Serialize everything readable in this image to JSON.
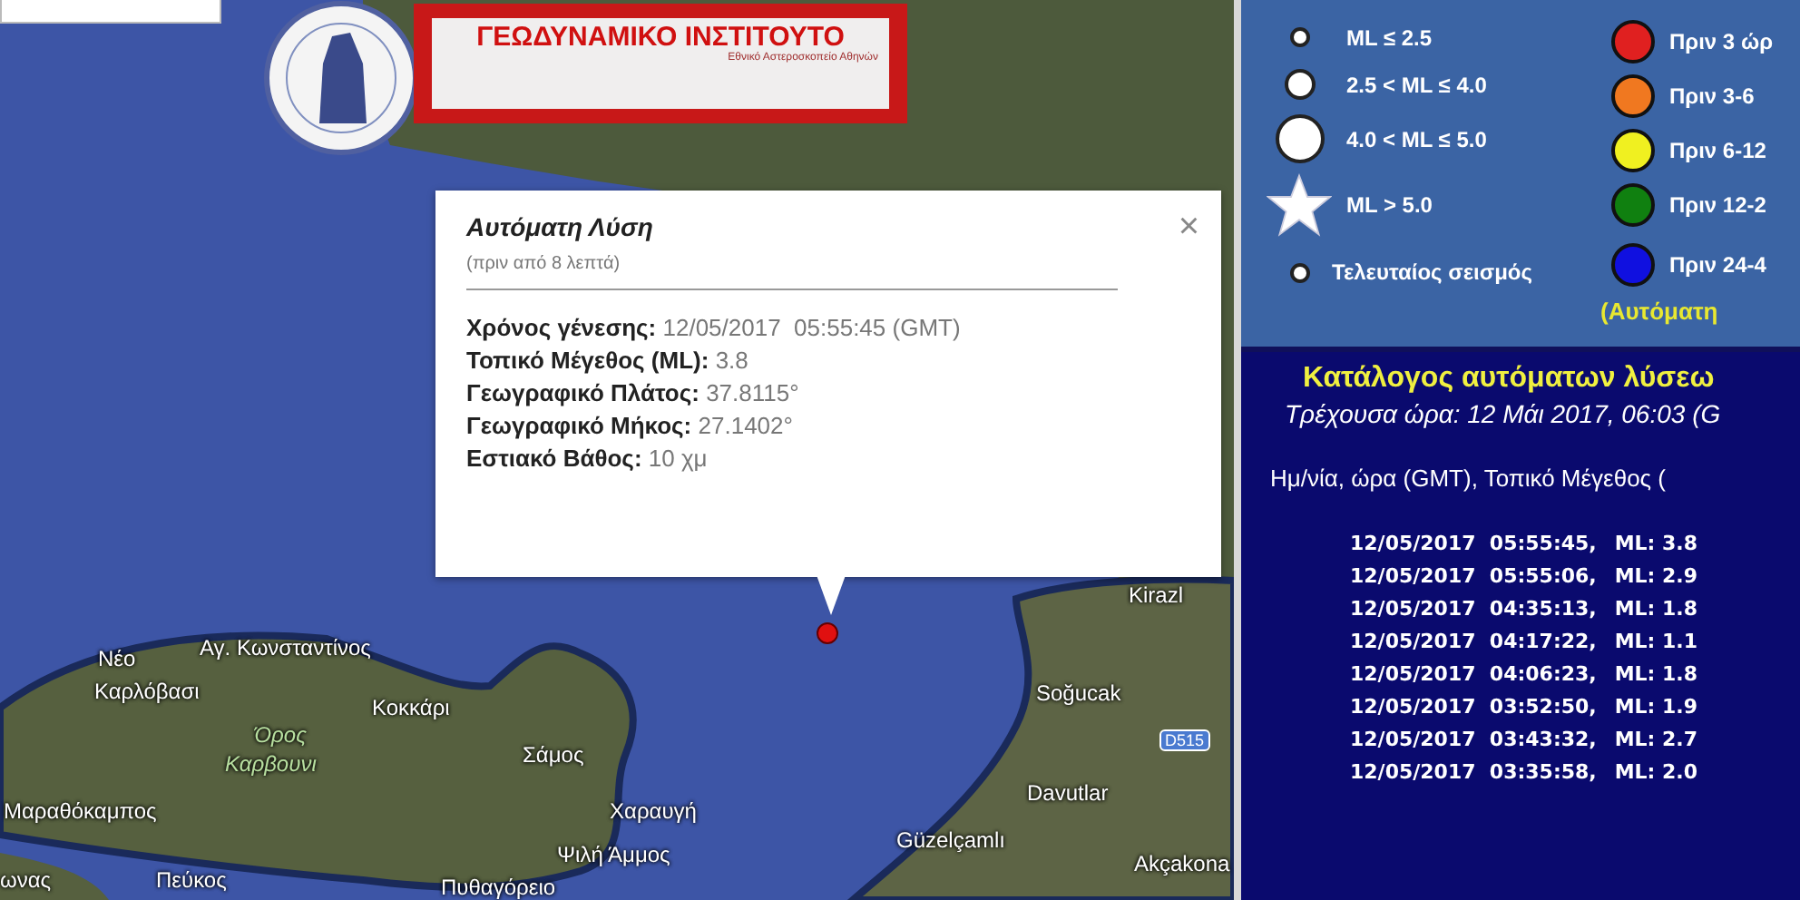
{
  "logo": {
    "title": "ΓΕΩΔΥΝΑΜΙΚΟ ΙΝΣΤΙΤΟΥΤΟ",
    "subtitle": "Εθνικό Αστεροσκοπείο Αθηνών"
  },
  "popup": {
    "title": "Αυτόματη Λύση",
    "subtitle": "(πριν από 8 λεπτά)",
    "close": "×",
    "fields": [
      {
        "label": "Χρόνος γένεσης:",
        "value": "12/05/2017  05:55:45 (GMT)"
      },
      {
        "label": "Τοπικό Μέγεθος (ML):",
        "value": "3.8"
      },
      {
        "label": "Γεωγραφικό Πλάτος:",
        "value": "37.8115°"
      },
      {
        "label": "Γεωγραφικό Μήκος:",
        "value": "27.1402°"
      },
      {
        "label": "Εστιακό Βάθος:",
        "value": "10 χμ"
      }
    ]
  },
  "map": {
    "labels": [
      {
        "text": "Νέο",
        "kind": "place"
      },
      {
        "text": "Καρλόβασι",
        "kind": "place"
      },
      {
        "text": "Αγ. Κωνσταντίνος",
        "kind": "place"
      },
      {
        "text": "Κοκκάρι",
        "kind": "place"
      },
      {
        "text": "Όρος",
        "kind": "mountain"
      },
      {
        "text": "Καρβουνι",
        "kind": "mountain"
      },
      {
        "text": "Σάμος",
        "kind": "place"
      },
      {
        "text": "Μαραθόκαμπος",
        "kind": "place"
      },
      {
        "text": "Χαραυγή",
        "kind": "place"
      },
      {
        "text": "Ψιλή Άμμος",
        "kind": "place"
      },
      {
        "text": "ωνας",
        "kind": "place"
      },
      {
        "text": "Πεύκος",
        "kind": "place"
      },
      {
        "text": "Πυθαγόρειο",
        "kind": "place"
      },
      {
        "text": "Kirazl",
        "kind": "place"
      },
      {
        "text": "Soğucak",
        "kind": "place"
      },
      {
        "text": "D515",
        "kind": "road"
      },
      {
        "text": "Davutlar",
        "kind": "place"
      },
      {
        "text": "Güzelçamlı",
        "kind": "place"
      },
      {
        "text": "Akçakona",
        "kind": "place"
      }
    ]
  },
  "legend": {
    "magnitudes": [
      {
        "label": "ML ≤ 2.5",
        "kind": "small"
      },
      {
        "label": "2.5 < ML ≤ 4.0",
        "kind": "medium"
      },
      {
        "label": "4.0 < ML ≤ 5.0",
        "kind": "large"
      },
      {
        "label": "ML > 5.0",
        "kind": "star"
      }
    ],
    "latest": "Τελευταίος σεισμός",
    "ages": [
      {
        "label": "Πριν 3 ώρ",
        "color": "#e02020"
      },
      {
        "label": "Πριν 3-6",
        "color": "#f07820"
      },
      {
        "label": "Πριν 6-12",
        "color": "#f0f020"
      },
      {
        "label": "Πριν 12-2",
        "color": "#108010"
      },
      {
        "label": "Πριν 24-4",
        "color": "#1010e0"
      }
    ],
    "note": "(Αυτόματη"
  },
  "catalog": {
    "title": "Κατάλογος αυτόματων λύσεω",
    "current_time": "Τρέχουσα ώρα: 12 Μάι 2017, 06:03 (G",
    "header": "Ημ/νία, ώρα (GMT), Τοπικό Μέγεθος (",
    "rows": [
      {
        "datetime": "12/05/2017  05:55:45,",
        "magnitude": "ML: 3.8"
      },
      {
        "datetime": "12/05/2017  05:55:06,",
        "magnitude": "ML: 2.9"
      },
      {
        "datetime": "12/05/2017  04:35:13,",
        "magnitude": "ML: 1.8"
      },
      {
        "datetime": "12/05/2017  04:17:22,",
        "magnitude": "ML: 1.1"
      },
      {
        "datetime": "12/05/2017  04:06:23,",
        "magnitude": "ML: 1.8"
      },
      {
        "datetime": "12/05/2017  03:52:50,",
        "magnitude": "ML: 1.9"
      },
      {
        "datetime": "12/05/2017  03:43:32,",
        "magnitude": "ML: 2.7"
      },
      {
        "datetime": "12/05/2017  03:35:58,",
        "magnitude": "ML: 2.0"
      }
    ]
  }
}
